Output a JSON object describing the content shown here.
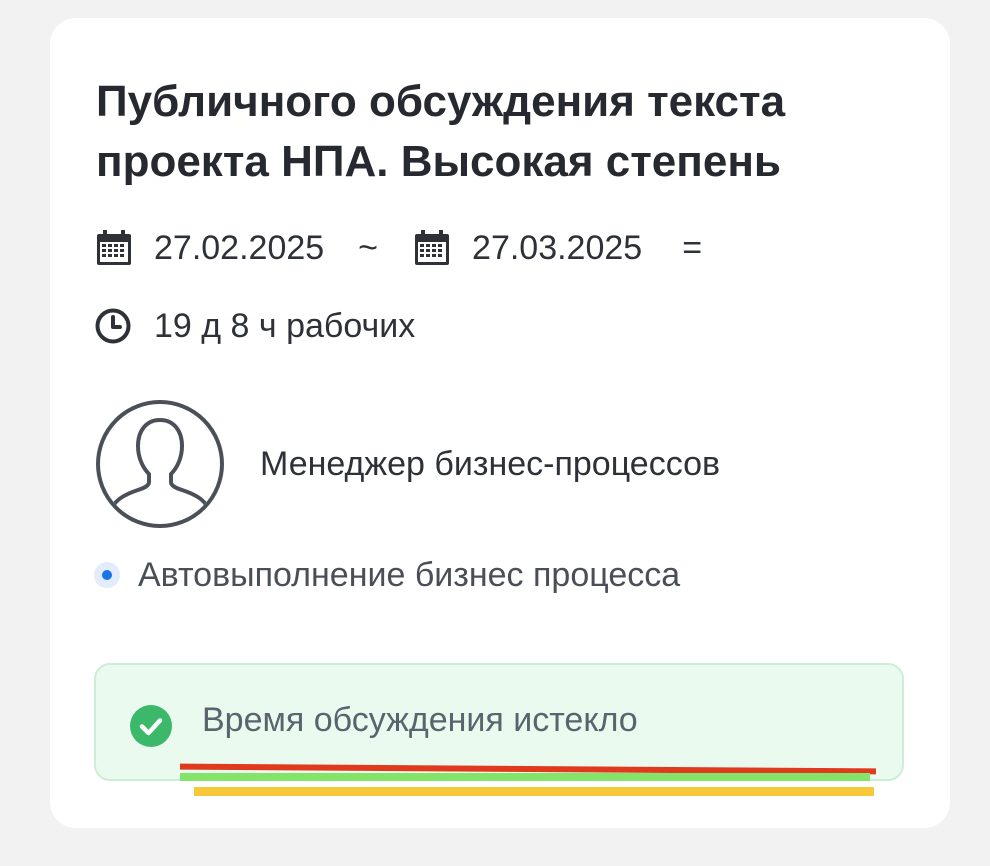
{
  "task": {
    "title": "Публичного обсуждения текста проекта НПА. Высокая степень",
    "start_date": "27.02.2025",
    "range_separator": "~",
    "end_date": "27.03.2025",
    "equals_sign": "=",
    "duration": "19 д 8 ч рабочих",
    "assignee": "Менеджер бизнес-процессов",
    "status": "Автовыполнение бизнес процесса",
    "alert_message": "Время обсуждения истекло"
  },
  "icons": {
    "calendar": "calendar-icon",
    "clock": "clock-icon",
    "avatar": "user-avatar-icon",
    "status_dot": "status-dot-icon",
    "check": "check-circle-icon"
  },
  "colors": {
    "alert_bg": "#eafaee",
    "alert_check": "#3bb86a",
    "status_dot": "#1a73e8",
    "underline_red": "#e03a1e",
    "underline_green": "#84e46a",
    "underline_yellow": "#f6c83a"
  }
}
